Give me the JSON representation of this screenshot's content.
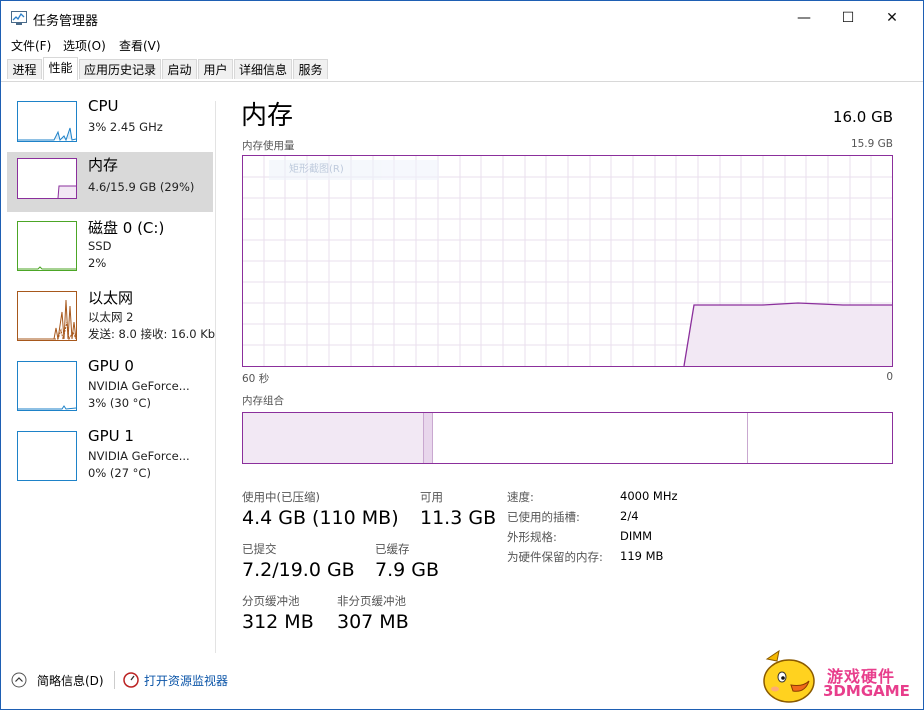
{
  "window": {
    "title": "任务管理器",
    "minimize_glyph": "—",
    "maximize_glyph": "☐",
    "close_glyph": "✕"
  },
  "menu": [
    "文件(F)",
    "选项(O)",
    "查看(V)"
  ],
  "tabs": [
    {
      "label": "进程",
      "active": false
    },
    {
      "label": "性能",
      "active": true
    },
    {
      "label": "应用历史记录",
      "active": false
    },
    {
      "label": "启动",
      "active": false
    },
    {
      "label": "用户",
      "active": false
    },
    {
      "label": "详细信息",
      "active": false
    },
    {
      "label": "服务",
      "active": false
    }
  ],
  "sidebar": {
    "items": [
      {
        "name": "CPU",
        "line1": "3% 2.45 GHz",
        "line2": "",
        "accent": "#1e82c8",
        "selected": false
      },
      {
        "name": "内存",
        "line1": "4.6/15.9 GB (29%)",
        "line2": "",
        "accent": "#8b2f9c",
        "selected": true
      },
      {
        "name": "磁盘 0 (C:)",
        "line1": "SSD",
        "line2": "2%",
        "accent": "#4ca626",
        "selected": false
      },
      {
        "name": "以太网",
        "line1": "以太网 2",
        "line2": "发送: 8.0  接收: 16.0 Kb",
        "accent": "#a7581c",
        "selected": false
      },
      {
        "name": "GPU 0",
        "line1": "NVIDIA GeForce...",
        "line2": "3% (30 °C)",
        "accent": "#1e82c8",
        "selected": false
      },
      {
        "name": "GPU 1",
        "line1": "NVIDIA GeForce...",
        "line2": "0% (27 °C)",
        "accent": "#1e82c8",
        "selected": false
      }
    ]
  },
  "main": {
    "title": "内存",
    "total": "16.0 GB",
    "usage_graph": {
      "label": "内存使用量",
      "max_label": "15.9 GB",
      "left_time": "60 秒",
      "right_time": "0",
      "tooltip": "矩形截图(R)",
      "color": "#8b2f9c",
      "fill": "#f2e8f4"
    },
    "composition_label": "内存组合",
    "stats": {
      "in_use_label": "使用中(已压缩)",
      "in_use_value": "4.4 GB (110 MB)",
      "available_label": "可用",
      "available_value": "11.3 GB",
      "committed_label": "已提交",
      "committed_value": "7.2/19.0 GB",
      "cached_label": "已缓存",
      "cached_value": "7.9 GB",
      "paged_label": "分页缓冲池",
      "paged_value": "312 MB",
      "nonpaged_label": "非分页缓冲池",
      "nonpaged_value": "307 MB"
    },
    "details": [
      {
        "label": "速度:",
        "value": "4000 MHz"
      },
      {
        "label": "已使用的插槽:",
        "value": "2/4"
      },
      {
        "label": "外形规格:",
        "value": "DIMM"
      },
      {
        "label": "为硬件保留的内存:",
        "value": "119 MB"
      }
    ]
  },
  "footer": {
    "brief_label": "简略信息(D)",
    "monitor_label": "打开资源监视器"
  },
  "watermark": {
    "line1": "游戏硬件",
    "line2": "3DMGAME"
  }
}
